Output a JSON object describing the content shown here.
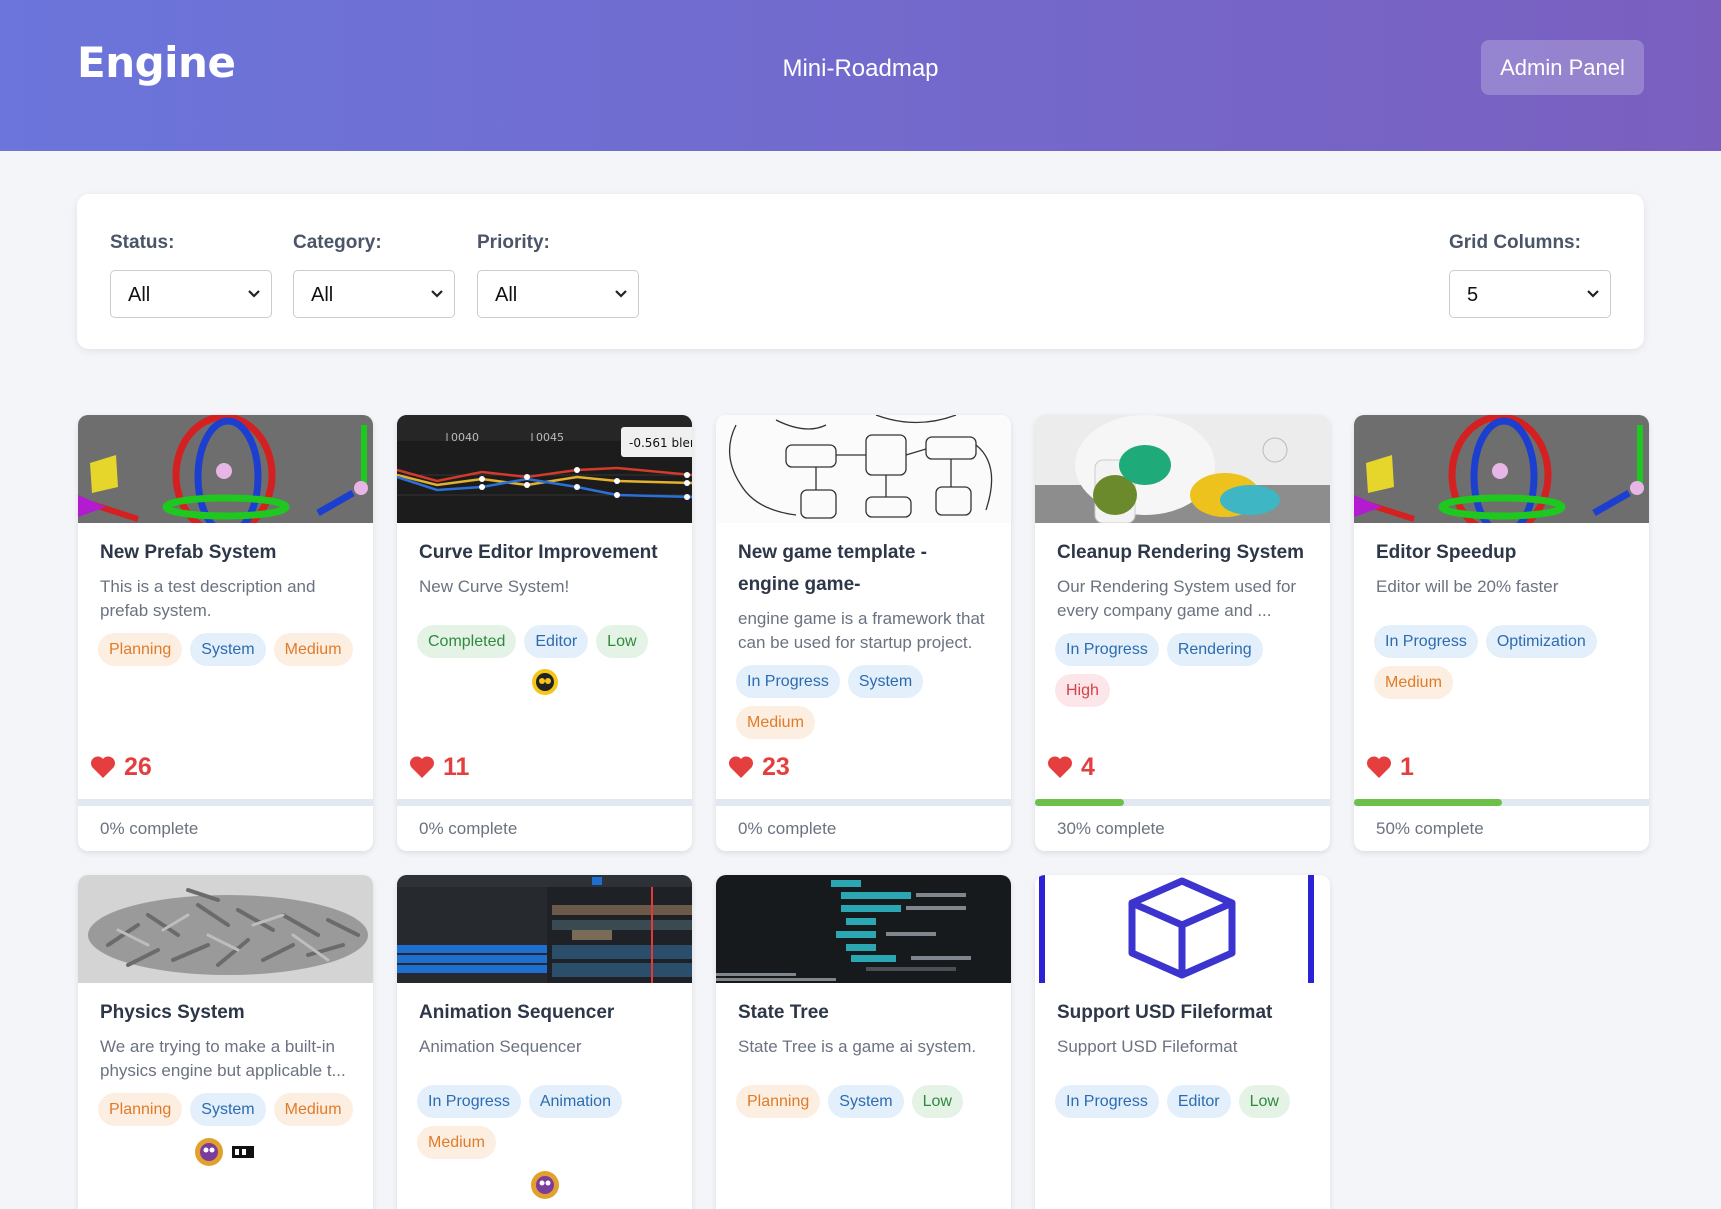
{
  "header": {
    "logo": "Engine",
    "subtitle": "Mini-Roadmap",
    "admin_label": "Admin Panel"
  },
  "filters": {
    "status": {
      "label": "Status:",
      "value": "All"
    },
    "category": {
      "label": "Category:",
      "value": "All"
    },
    "priority": {
      "label": "Priority:",
      "value": "All"
    },
    "grid_columns": {
      "label": "Grid Columns:",
      "value": "5"
    }
  },
  "cards": [
    {
      "title": "New Prefab System",
      "description": "This is a test description and prefab system.",
      "status": "Planning",
      "category": "System",
      "priority": "Medium",
      "likes": "26",
      "progress": 0,
      "progress_text": "0% complete",
      "thumb": "gizmo"
    },
    {
      "title": "Curve Editor Improvement",
      "description": "New Curve System!",
      "status": "Completed",
      "category": "Editor",
      "priority": "Low",
      "likes": "11",
      "progress": 0,
      "progress_text": "0% complete",
      "thumb": "curve",
      "thumb_labels": [
        "0040",
        "0045",
        "-0.561 blen"
      ]
    },
    {
      "title": "New game template - engine game-",
      "description": "engine game is a framework that can be used for startup project.",
      "status": "In Progress",
      "category": "System",
      "priority": "Medium",
      "likes": "23",
      "progress": 0,
      "progress_text": "0% complete",
      "thumb": "sketch"
    },
    {
      "title": "Cleanup Rendering System",
      "description": "Our Rendering System used for every company game and ...",
      "status": "In Progress",
      "category": "Rendering",
      "priority": "High",
      "likes": "4",
      "progress": 30,
      "progress_text": "30% complete",
      "thumb": "photo"
    },
    {
      "title": "Editor Speedup",
      "description": "Editor will be 20% faster",
      "status": "In Progress",
      "category": "Optimization",
      "priority": "Medium",
      "likes": "1",
      "progress": 50,
      "progress_text": "50% complete",
      "thumb": "gizmo"
    },
    {
      "title": "Physics System",
      "description": "We are trying to make a built-in physics engine but applicable t...",
      "status": "Planning",
      "category": "System",
      "priority": "Medium",
      "thumb": "physics"
    },
    {
      "title": "Animation Sequencer",
      "description": "Animation Sequencer",
      "status": "In Progress",
      "category": "Animation",
      "priority": "Medium",
      "thumb": "sequencer"
    },
    {
      "title": "State Tree",
      "description": "State Tree is a game ai system.",
      "status": "Planning",
      "category": "System",
      "priority": "Low",
      "thumb": "statetree"
    },
    {
      "title": "Support USD Fileformat",
      "description": "Support USD Fileformat",
      "status": "In Progress",
      "category": "Editor",
      "priority": "Low",
      "thumb": "cube"
    }
  ],
  "colors": {
    "header_from": "#6b75db",
    "header_to": "#7a5fbf",
    "like": "#e53e3e",
    "progress": "#6cc04a"
  }
}
